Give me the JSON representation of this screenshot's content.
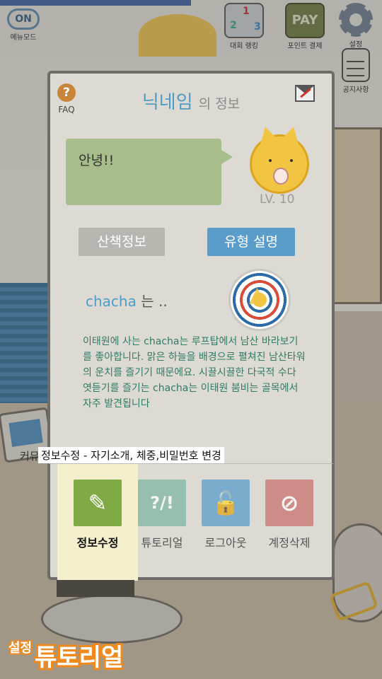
{
  "top_bar": {
    "menu_mode_badge": "ON",
    "menu_mode_label": "메뉴모드",
    "ranking_label": "대회 랭킹",
    "ranking_digits": [
      "1",
      "2",
      "3"
    ],
    "pay_badge": "PAY",
    "pay_label": "포인트 결제",
    "settings_label": "설정",
    "notice_label": "공지사항"
  },
  "background": {
    "partial_label": "커뮤"
  },
  "profile": {
    "faq_icon": "?",
    "faq_label": "FAQ",
    "nickname": "닉네임",
    "title_suffix": "의 정보",
    "greeting": "안녕!!",
    "level": "LV. 10",
    "walk_info_button": "산책정보",
    "type_desc_button": "유형 설명",
    "type_name": "chacha",
    "type_suffix": " 는 ..",
    "description": "이태원에 사는 chacha는 루프탑에서 남산 바라보기를 좋아합니다. 맑은 하늘을 배경으로 펼쳐진 남산타워의 운치를 즐기기 때문에요. 시끌시끌한 다국적 수다 엿듣기를 즐기는 chacha는 이태원 붐비는 골목에서 자주 발견됩니다"
  },
  "tooltip": "정보수정 - 자기소개, 체중,비밀번호 변경",
  "menu": {
    "items": [
      {
        "label": "정보수정",
        "icon": "pencil-icon",
        "glyph": "✎"
      },
      {
        "label": "튜토리얼",
        "icon": "question-exclaim-icon",
        "glyph": "?/!"
      },
      {
        "label": "로그아웃",
        "icon": "unlock-icon",
        "glyph": "🔓"
      },
      {
        "label": "계정삭제",
        "icon": "prohibit-icon",
        "glyph": "⊘"
      }
    ],
    "active_index": 0
  },
  "caption": {
    "small": "설정",
    "big": "튜토리얼"
  },
  "colors": {
    "accent_blue": "#5a9dcb",
    "accent_green": "#7faa46",
    "caption_orange": "#f08a1d",
    "description_text": "#2f7c64"
  }
}
